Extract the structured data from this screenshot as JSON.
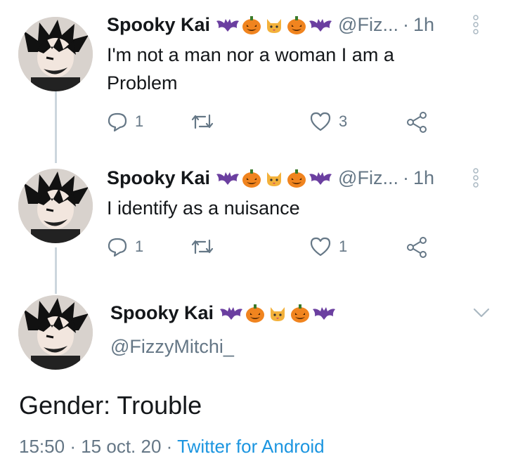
{
  "tweets": [
    {
      "name": "Spooky Kai",
      "handle": "@Fiz...",
      "separator": "·",
      "time": "1h",
      "text": "I'm not a man nor a woman I am a Problem",
      "reply_count": "1",
      "retweet_count": "",
      "like_count": "3"
    },
    {
      "name": "Spooky Kai",
      "handle": "@Fiz...",
      "separator": "·",
      "time": "1h",
      "text": "I identify as a nuisance",
      "reply_count": "1",
      "retweet_count": "",
      "like_count": "1"
    }
  ],
  "main_tweet": {
    "name": "Spooky Kai",
    "handle": "@FizzyMitchi_",
    "text": "Gender: Trouble",
    "time": "15:50",
    "sep1": "·",
    "date": "15 oct. 20",
    "sep2": "·",
    "source": "Twitter for Android"
  },
  "icons": {
    "name_emojis": [
      "bat-icon",
      "pumpkin-icon",
      "cat-icon",
      "pumpkin-icon",
      "bat-icon"
    ],
    "actions": [
      "reply-icon",
      "retweet-icon",
      "like-icon",
      "share-icon"
    ],
    "more": "more-vertical-icon",
    "caret": "chevron-down-icon"
  },
  "colors": {
    "text": "#14171a",
    "muted": "#657786",
    "link": "#1b95e0",
    "thread_line": "#ccd6dd",
    "pumpkin": "#f0841f",
    "bat": "#6b3fa0"
  }
}
